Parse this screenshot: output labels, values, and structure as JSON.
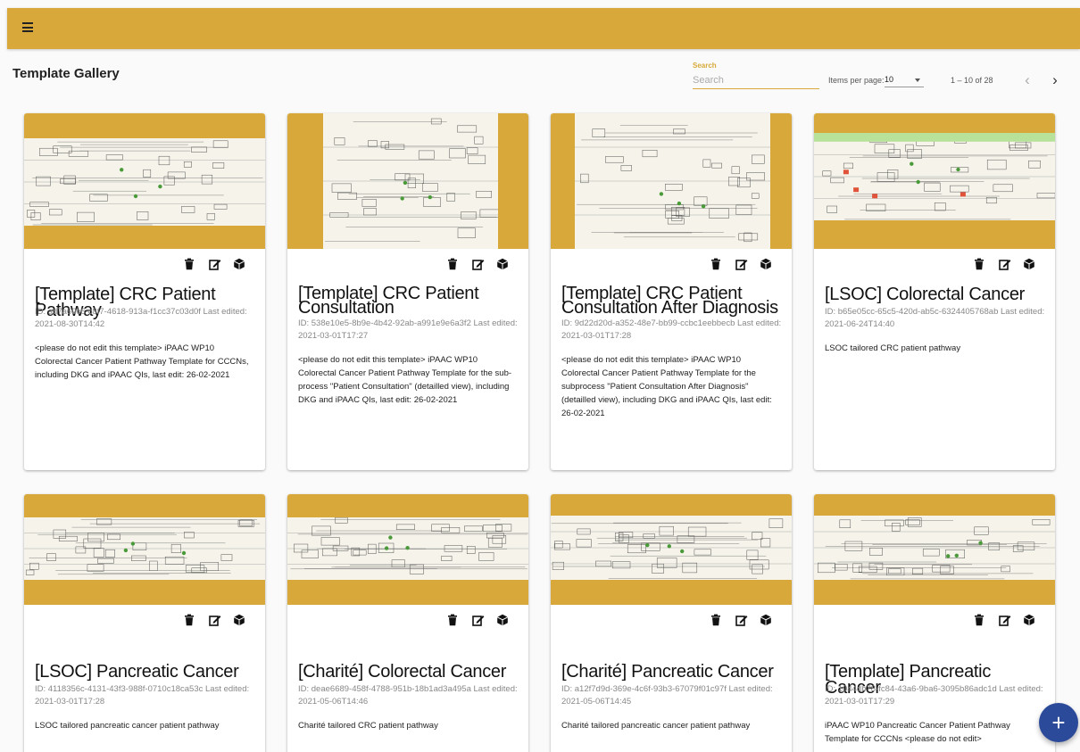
{
  "toolbar": {
    "menu_icon": "menu-icon"
  },
  "header": {
    "title": "Template Gallery"
  },
  "search": {
    "label": "Search",
    "placeholder": "Search"
  },
  "pagination": {
    "items_per_page_label": "Items per page:",
    "items_per_page_value": "10",
    "range": "1 – 10 of 28",
    "prev_icon": "chevron-left-icon",
    "next_icon": "chevron-right-icon"
  },
  "card_actions": {
    "delete_icon": "trash-icon",
    "edit_icon": "edit-icon",
    "open_icon": "cube-icon"
  },
  "cards": [
    {
      "title": "[Template] CRC Patient Pathway",
      "meta": "ID: ad7a60c6-c8f7-4618-913a-f1cc37c03d0f Last edited: 2021-08-30T14:42",
      "description": "<please do not edit this template> iPAAC WP10 Colorectal Cancer Patient Pathway Template for CCCNs, including DKG and iPAAC QIs, last edit: 26-02-2021"
    },
    {
      "title": "[Template] CRC Patient Consultation",
      "meta": "ID: 538e10e5-8b9e-4b42-92ab-a991e9e6a3f2 Last edited: 2021-03-01T17:27",
      "description": "<please do not edit this template> iPAAC WP10 Colorectal Cancer Patient Pathway Template for the sub-process \"Patient Consultation\" (detailled view), including DKG and iPAAC QIs, last edit: 26-02-2021"
    },
    {
      "title": "[Template] CRC Patient Consultation After Diagnosis",
      "meta": "ID: 9d22d20d-a352-48e7-bb99-ccbc1eebbecb Last edited: 2021-03-01T17:28",
      "description": "<please do not edit this template> iPAAC WP10 Colorectal Cancer Patient Pathway Template for the subprocess \"Patient Consultation After Diagnosis\" (detailled view), including DKG and iPAAC QIs, last edit: 26-02-2021"
    },
    {
      "title": "[LSOC] Colorectal Cancer",
      "meta": "ID: b65e05cc-65c5-420d-ab5c-6324405768ab Last edited: 2021-06-24T14:40",
      "description": "LSOC tailored CRC patient pathway"
    },
    {
      "title": "[LSOC] Pancreatic Cancer",
      "meta": "ID: 4118356c-4131-43f3-988f-0710c18ca53c Last edited: 2021-03-01T17:28",
      "description": "LSOC tailored pancreatic cancer patient pathway"
    },
    {
      "title": "[Charité] Colorectal Cancer",
      "meta": "ID: deae6689-458f-4788-951b-18b1ad3a495a Last edited: 2021-05-06T14:46",
      "description": "Charité tailored CRC patient pathway"
    },
    {
      "title": "[Charité] Pancreatic Cancer",
      "meta": "ID: a12f7d9d-369e-4c6f-93b3-67079f01c97f Last edited: 2021-05-06T14:45",
      "description": "Charité tailored pancreatic cancer patient pathway"
    },
    {
      "title": "[Template] Pancreatic Cancer",
      "meta": "ID: 1044db78-fc84-43a6-9ba6-3095b86adc1d Last edited: 2021-03-01T17:29",
      "description": "iPAAC WP10 Pancreatic Cancer Patient Pathway Template for CCCNs <please do not edit>"
    }
  ],
  "fab": {
    "label": "+",
    "icon": "add-icon"
  },
  "colors": {
    "accent": "#d8a93a",
    "fab": "#2c4a9a"
  }
}
